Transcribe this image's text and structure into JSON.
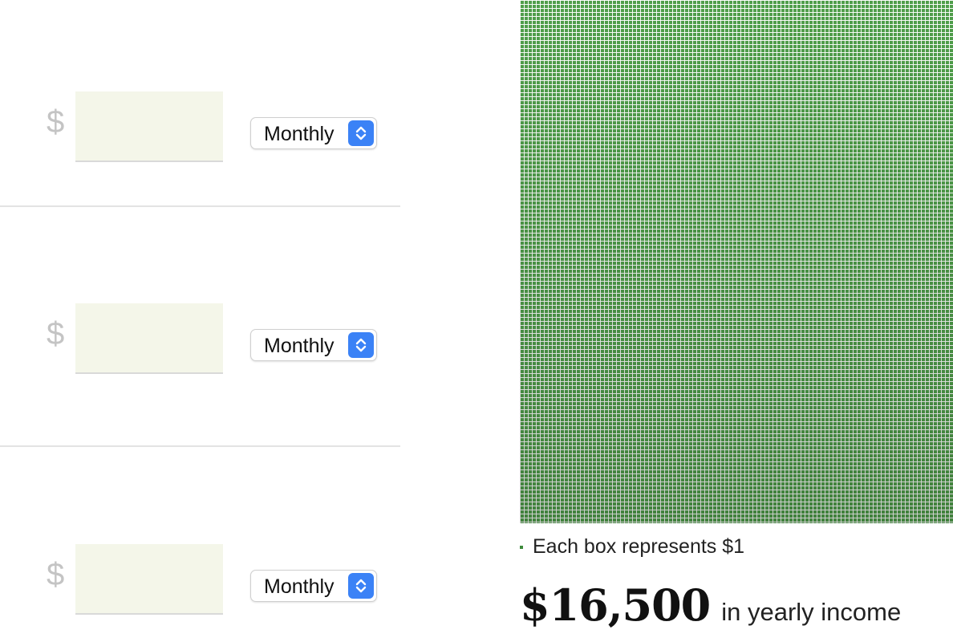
{
  "income_rows": [
    {
      "currency_symbol": "$",
      "amount_value": "",
      "frequency": "Monthly"
    },
    {
      "currency_symbol": "$",
      "amount_value": "",
      "frequency": "Monthly"
    },
    {
      "currency_symbol": "$",
      "amount_value": "",
      "frequency": "Monthly"
    }
  ],
  "visualization": {
    "box_color": "#4f9e4a",
    "legend_text": "Each box represents $1"
  },
  "summary": {
    "total": "$16,500",
    "caption": "in yearly income"
  },
  "colors": {
    "input_background": "#f4f6e9",
    "select_accent": "#3b82f6",
    "dollar_sign": "#c4c4c4",
    "grid_green": "#4f9e4a"
  }
}
